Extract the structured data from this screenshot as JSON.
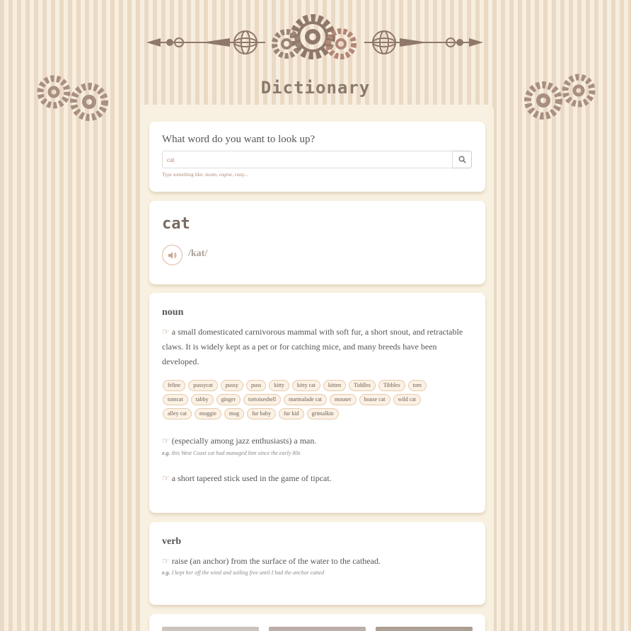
{
  "header": {
    "title": "Dictionary"
  },
  "search": {
    "label": "What word do you want to look up?",
    "value": "cat",
    "hint_prefix": "Type something like: ",
    "hint_examples": "steam, engine, rusty..."
  },
  "entry": {
    "word": "cat",
    "phonetic": "/kat/"
  },
  "noun": {
    "pos": "noun",
    "definitions": [
      {
        "text": "a small domesticated carnivorous mammal with soft fur, a short snout, and retractable claws. It is widely kept as a pet or for catching mice, and many breeds have been developed."
      },
      {
        "text": "(especially among jazz enthusiasts) a man.",
        "example_prefix": "e.g.",
        "example": "this West Coast cat had managed him since the early 80s"
      },
      {
        "text": "a short tapered stick used in the game of tipcat."
      }
    ],
    "synonyms": [
      [
        "feline",
        "pussycat",
        "pussy",
        "puss",
        "kitty",
        "kitty cat",
        "kitten",
        "Tiddles",
        "Tibbles",
        "tom"
      ],
      [
        "tomcat",
        "tabby",
        "ginger",
        "tortoiseshell",
        "marmalade cat",
        "mouser",
        "house cat",
        "wild cat"
      ],
      [
        "alley cat",
        "moggie",
        "mog",
        "fur baby",
        "fur kid",
        "grimalkin"
      ]
    ]
  },
  "verb": {
    "pos": "verb",
    "definition": "raise (an anchor) from the surface of the water to the cathead.",
    "example_prefix": "e.g.",
    "example": "I kept her off the wind and sailing free until I had the anchor catted"
  },
  "icons": {
    "definition_marker": "hand-pointing-icon",
    "search": "search-icon",
    "audio": "speaker-icon"
  },
  "colors": {
    "accent": "#c08a74",
    "stripe_dark": "#ead9c4",
    "stripe_light": "#f8eedf",
    "gear": "#8f786a"
  }
}
